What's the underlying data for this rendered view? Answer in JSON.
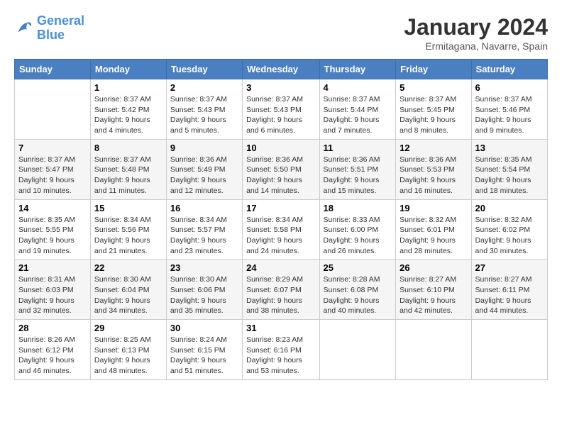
{
  "header": {
    "logo_line1": "General",
    "logo_line2": "Blue",
    "month": "January 2024",
    "location": "Ermitagana, Navarre, Spain"
  },
  "days_of_week": [
    "Sunday",
    "Monday",
    "Tuesday",
    "Wednesday",
    "Thursday",
    "Friday",
    "Saturday"
  ],
  "weeks": [
    [
      {
        "num": "",
        "info": ""
      },
      {
        "num": "1",
        "info": "Sunrise: 8:37 AM\nSunset: 5:42 PM\nDaylight: 9 hours\nand 4 minutes."
      },
      {
        "num": "2",
        "info": "Sunrise: 8:37 AM\nSunset: 5:43 PM\nDaylight: 9 hours\nand 5 minutes."
      },
      {
        "num": "3",
        "info": "Sunrise: 8:37 AM\nSunset: 5:43 PM\nDaylight: 9 hours\nand 6 minutes."
      },
      {
        "num": "4",
        "info": "Sunrise: 8:37 AM\nSunset: 5:44 PM\nDaylight: 9 hours\nand 7 minutes."
      },
      {
        "num": "5",
        "info": "Sunrise: 8:37 AM\nSunset: 5:45 PM\nDaylight: 9 hours\nand 8 minutes."
      },
      {
        "num": "6",
        "info": "Sunrise: 8:37 AM\nSunset: 5:46 PM\nDaylight: 9 hours\nand 9 minutes."
      }
    ],
    [
      {
        "num": "7",
        "info": "Sunrise: 8:37 AM\nSunset: 5:47 PM\nDaylight: 9 hours\nand 10 minutes."
      },
      {
        "num": "8",
        "info": "Sunrise: 8:37 AM\nSunset: 5:48 PM\nDaylight: 9 hours\nand 11 minutes."
      },
      {
        "num": "9",
        "info": "Sunrise: 8:36 AM\nSunset: 5:49 PM\nDaylight: 9 hours\nand 12 minutes."
      },
      {
        "num": "10",
        "info": "Sunrise: 8:36 AM\nSunset: 5:50 PM\nDaylight: 9 hours\nand 14 minutes."
      },
      {
        "num": "11",
        "info": "Sunrise: 8:36 AM\nSunset: 5:51 PM\nDaylight: 9 hours\nand 15 minutes."
      },
      {
        "num": "12",
        "info": "Sunrise: 8:36 AM\nSunset: 5:53 PM\nDaylight: 9 hours\nand 16 minutes."
      },
      {
        "num": "13",
        "info": "Sunrise: 8:35 AM\nSunset: 5:54 PM\nDaylight: 9 hours\nand 18 minutes."
      }
    ],
    [
      {
        "num": "14",
        "info": "Sunrise: 8:35 AM\nSunset: 5:55 PM\nDaylight: 9 hours\nand 19 minutes."
      },
      {
        "num": "15",
        "info": "Sunrise: 8:34 AM\nSunset: 5:56 PM\nDaylight: 9 hours\nand 21 minutes."
      },
      {
        "num": "16",
        "info": "Sunrise: 8:34 AM\nSunset: 5:57 PM\nDaylight: 9 hours\nand 23 minutes."
      },
      {
        "num": "17",
        "info": "Sunrise: 8:34 AM\nSunset: 5:58 PM\nDaylight: 9 hours\nand 24 minutes."
      },
      {
        "num": "18",
        "info": "Sunrise: 8:33 AM\nSunset: 6:00 PM\nDaylight: 9 hours\nand 26 minutes."
      },
      {
        "num": "19",
        "info": "Sunrise: 8:32 AM\nSunset: 6:01 PM\nDaylight: 9 hours\nand 28 minutes."
      },
      {
        "num": "20",
        "info": "Sunrise: 8:32 AM\nSunset: 6:02 PM\nDaylight: 9 hours\nand 30 minutes."
      }
    ],
    [
      {
        "num": "21",
        "info": "Sunrise: 8:31 AM\nSunset: 6:03 PM\nDaylight: 9 hours\nand 32 minutes."
      },
      {
        "num": "22",
        "info": "Sunrise: 8:30 AM\nSunset: 6:04 PM\nDaylight: 9 hours\nand 34 minutes."
      },
      {
        "num": "23",
        "info": "Sunrise: 8:30 AM\nSunset: 6:06 PM\nDaylight: 9 hours\nand 35 minutes."
      },
      {
        "num": "24",
        "info": "Sunrise: 8:29 AM\nSunset: 6:07 PM\nDaylight: 9 hours\nand 38 minutes."
      },
      {
        "num": "25",
        "info": "Sunrise: 8:28 AM\nSunset: 6:08 PM\nDaylight: 9 hours\nand 40 minutes."
      },
      {
        "num": "26",
        "info": "Sunrise: 8:27 AM\nSunset: 6:10 PM\nDaylight: 9 hours\nand 42 minutes."
      },
      {
        "num": "27",
        "info": "Sunrise: 8:27 AM\nSunset: 6:11 PM\nDaylight: 9 hours\nand 44 minutes."
      }
    ],
    [
      {
        "num": "28",
        "info": "Sunrise: 8:26 AM\nSunset: 6:12 PM\nDaylight: 9 hours\nand 46 minutes."
      },
      {
        "num": "29",
        "info": "Sunrise: 8:25 AM\nSunset: 6:13 PM\nDaylight: 9 hours\nand 48 minutes."
      },
      {
        "num": "30",
        "info": "Sunrise: 8:24 AM\nSunset: 6:15 PM\nDaylight: 9 hours\nand 51 minutes."
      },
      {
        "num": "31",
        "info": "Sunrise: 8:23 AM\nSunset: 6:16 PM\nDaylight: 9 hours\nand 53 minutes."
      },
      {
        "num": "",
        "info": ""
      },
      {
        "num": "",
        "info": ""
      },
      {
        "num": "",
        "info": ""
      }
    ]
  ]
}
